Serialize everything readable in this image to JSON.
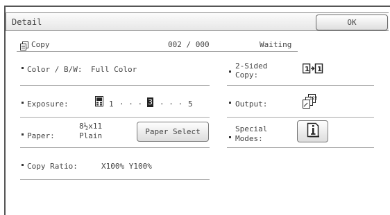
{
  "window": {
    "title": "Detail",
    "ok_label": "OK"
  },
  "status_row": {
    "mode_label": "Copy",
    "counter": "002 / 000",
    "status": "Waiting"
  },
  "settings": {
    "color": {
      "label": "Color / B/W:",
      "value": "Full Color"
    },
    "exposure": {
      "label": "Exposure:",
      "scale_min": "1",
      "scale_dots_1": "· · ·",
      "selected_level": "3",
      "scale_dots_2": "· · ·",
      "scale_max": "5"
    },
    "paper": {
      "label": "Paper:",
      "size": "8½x11",
      "type": "Plain",
      "select_button": "Paper Select"
    },
    "copy_ratio": {
      "label": "Copy Ratio:",
      "value": "X100% Y100%"
    },
    "two_sided": {
      "label_line1": "2-Sided",
      "label_line2": "Copy:",
      "icon": "1-to-1-icon"
    },
    "output": {
      "label": "Output:",
      "icon": "sorted-output-icon"
    },
    "special_modes": {
      "label_line1": "Special",
      "label_line2": "Modes:",
      "icon": "info-document-icon"
    }
  }
}
